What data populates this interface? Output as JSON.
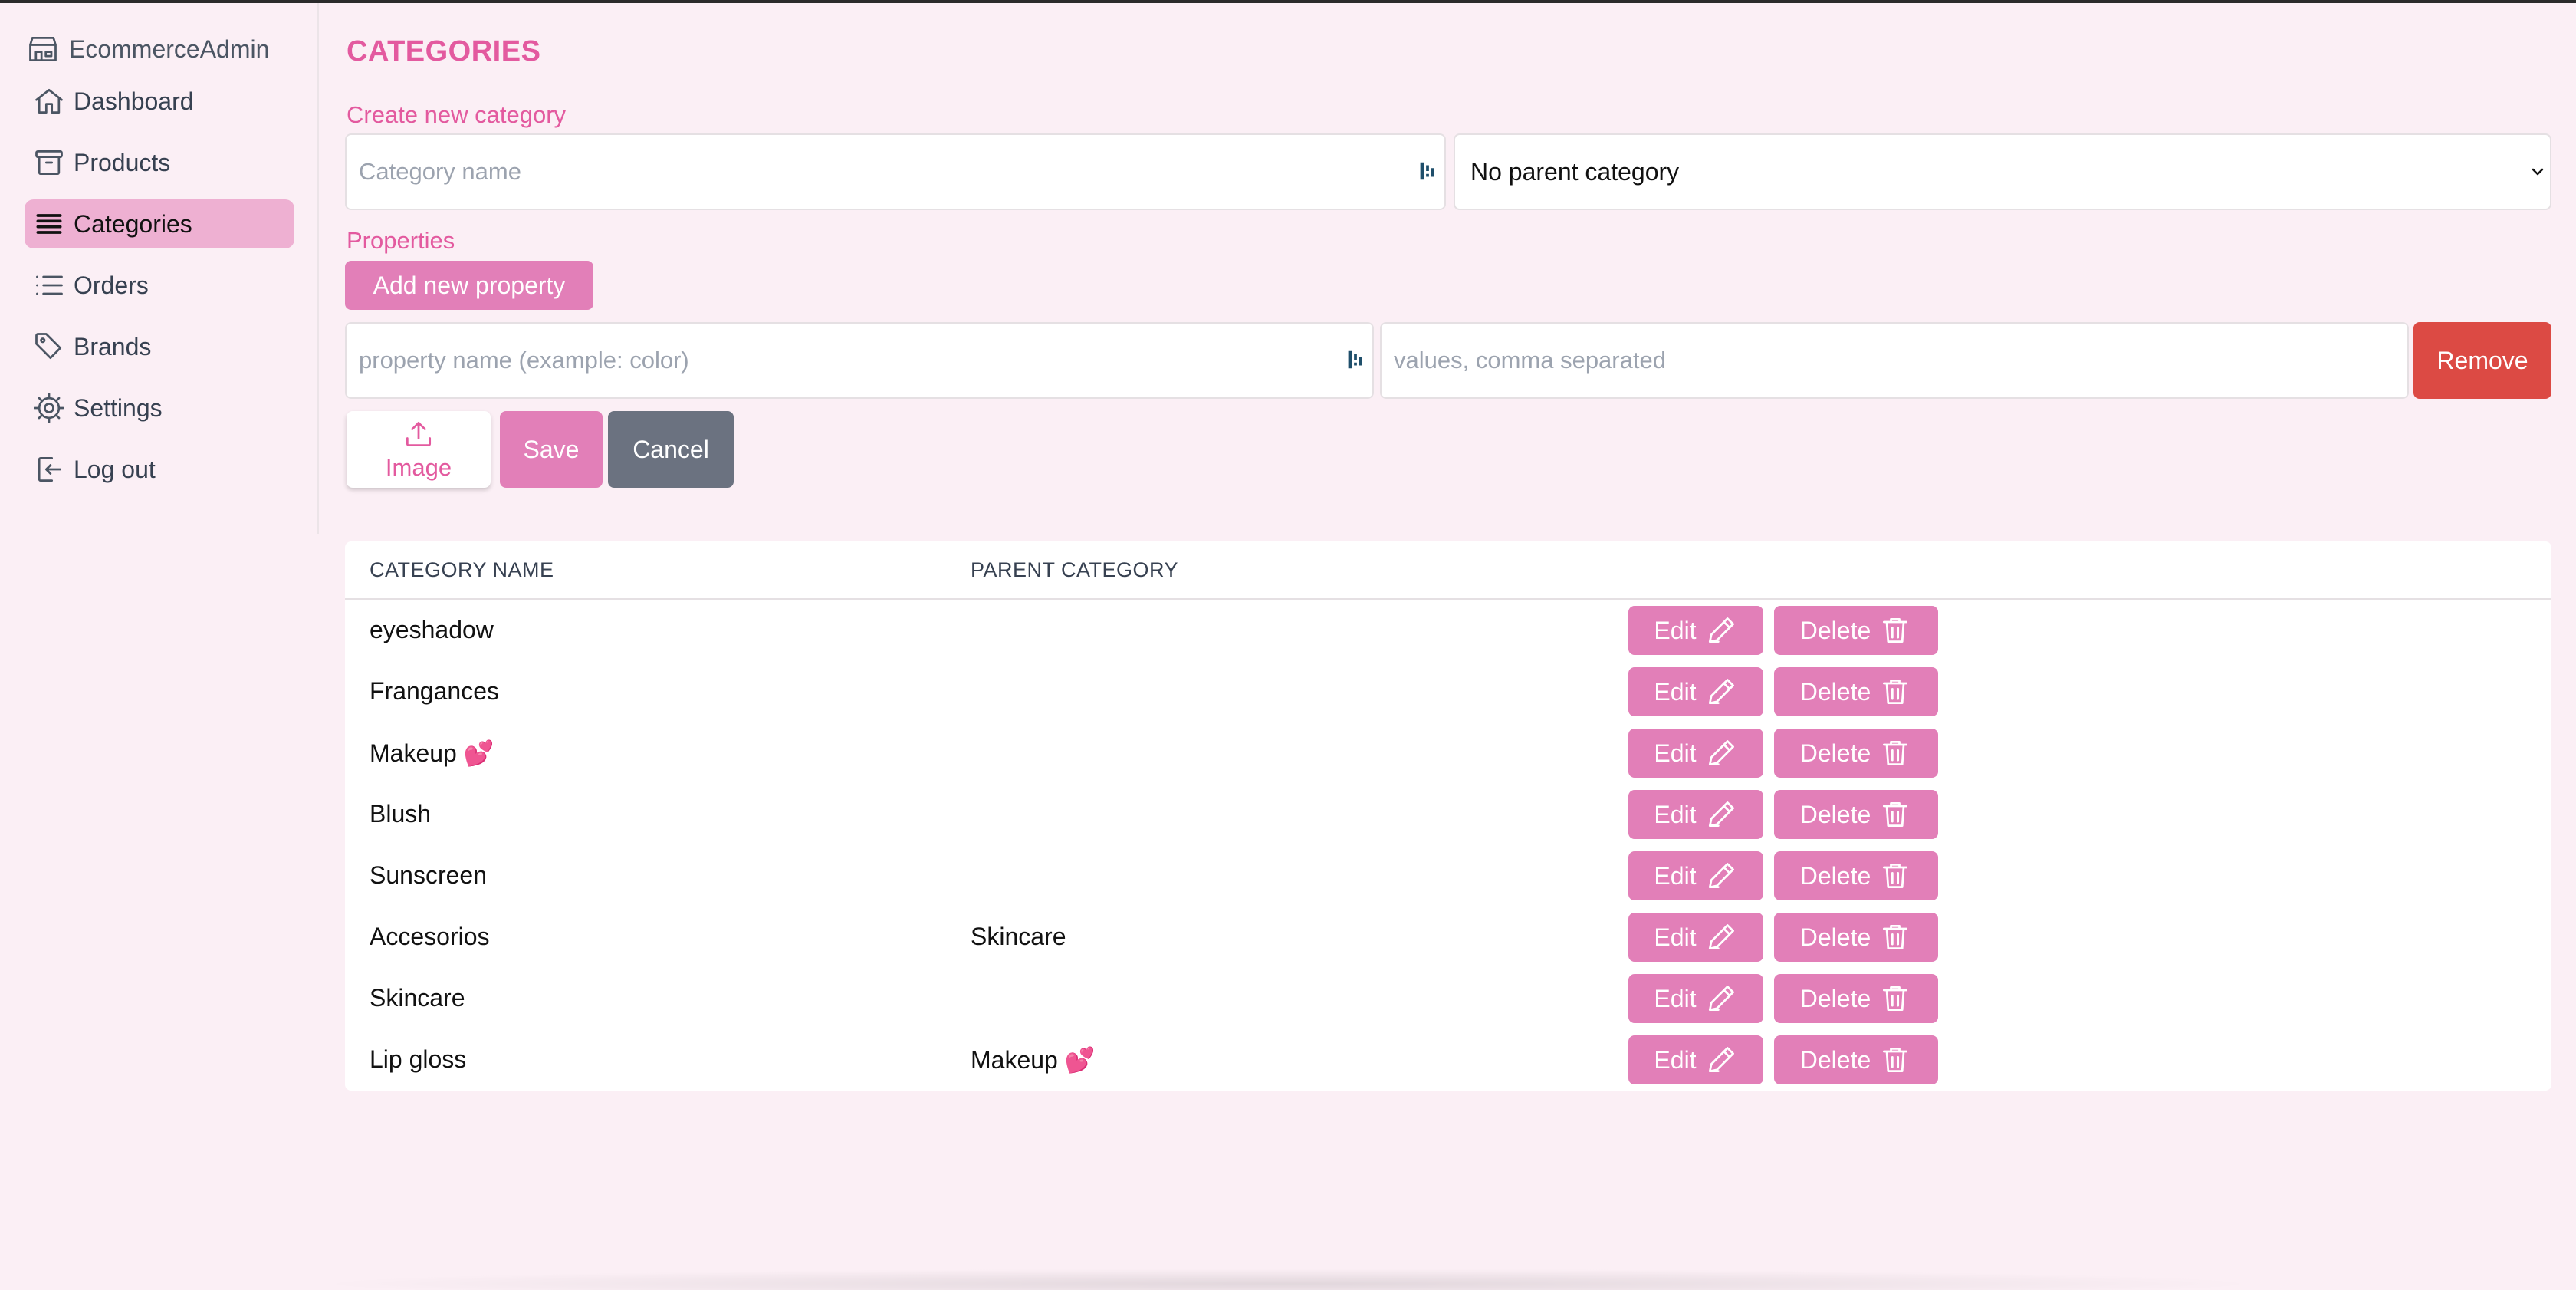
{
  "app": {
    "brand": "EcommerceAdmin",
    "brand_icon": "store-icon"
  },
  "sidebar": {
    "items": [
      {
        "label": "Dashboard",
        "icon": "home-icon"
      },
      {
        "label": "Products",
        "icon": "archive-box-icon"
      },
      {
        "label": "Categories",
        "icon": "list-bars-icon",
        "active": true
      },
      {
        "label": "Orders",
        "icon": "list-icon"
      },
      {
        "label": "Brands",
        "icon": "tag-icon"
      },
      {
        "label": "Settings",
        "icon": "gear-icon"
      },
      {
        "label": "Log out",
        "icon": "logout-icon"
      }
    ]
  },
  "page": {
    "title": "CATEGORIES"
  },
  "form": {
    "create_label": "Create new category",
    "category_name_placeholder": "Category name",
    "category_name_value": "",
    "parent_select_value": "No parent category",
    "properties_label": "Properties",
    "add_property_label": "Add new property",
    "property_name_placeholder": "property name (example: color)",
    "property_values_placeholder": "values, comma separated",
    "remove_label": "Remove",
    "image_label": "Image",
    "save_label": "Save",
    "cancel_label": "Cancel"
  },
  "table": {
    "headers": [
      "CATEGORY NAME",
      "PARENT CATEGORY"
    ],
    "edit_label": "Edit",
    "delete_label": "Delete",
    "rows": [
      {
        "name": "eyeshadow",
        "parent": ""
      },
      {
        "name": "Frangances",
        "parent": ""
      },
      {
        "name": "Makeup 💕",
        "parent": ""
      },
      {
        "name": "Blush",
        "parent": ""
      },
      {
        "name": "Sunscreen",
        "parent": ""
      },
      {
        "name": "Accesorios",
        "parent": "Skincare"
      },
      {
        "name": "Skincare",
        "parent": ""
      },
      {
        "name": "Lip gloss",
        "parent": "Makeup 💕"
      }
    ]
  },
  "colors": {
    "accent": "#e35a9f",
    "button_pink": "#e27fb8",
    "remove_red": "#dc4a44",
    "cancel_gray": "#6b7280",
    "background": "#fbeff5",
    "active_nav": "#eeb0d2"
  }
}
